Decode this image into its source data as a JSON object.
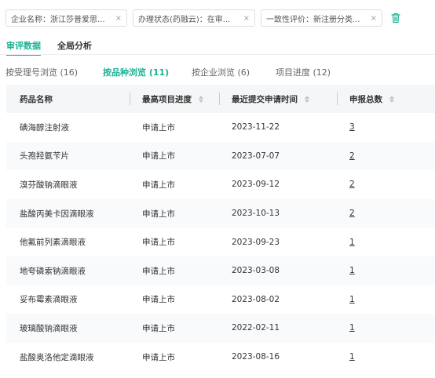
{
  "filters": [
    {
      "text": "企业名称：浙江莎普爱思...",
      "close": "×"
    },
    {
      "text": "办理状态(药融云)：在审...",
      "close": "×"
    },
    {
      "text": "一致性评价：新注册分类...",
      "close": "×"
    }
  ],
  "main_tabs": [
    "审评数据",
    "全局分析"
  ],
  "sub_tabs": [
    "按受理号浏览 (16)",
    "按品种浏览 (11)",
    "按企业浏览 (6)",
    "项目进度 (12)"
  ],
  "table": {
    "headers": [
      "药品名称",
      "最高项目进度",
      "最近提交申请时间",
      "申报总数"
    ],
    "rows": [
      [
        "碘海醇注射液",
        "申请上市",
        "2023-11-22",
        "3"
      ],
      [
        "头孢羟氨苄片",
        "申请上市",
        "2023-07-07",
        "2"
      ],
      [
        "溴芬酸钠滴眼液",
        "申请上市",
        "2023-09-12",
        "2"
      ],
      [
        "盐酸丙美卡因滴眼液",
        "申请上市",
        "2023-10-13",
        "2"
      ],
      [
        "他氟前列素滴眼液",
        "申请上市",
        "2023-09-23",
        "1"
      ],
      [
        "地夸磷索钠滴眼液",
        "申请上市",
        "2023-03-08",
        "1"
      ],
      [
        "妥布霉素滴眼液",
        "申请上市",
        "2023-08-02",
        "1"
      ],
      [
        "玻璃酸钠滴眼液",
        "申请上市",
        "2022-02-11",
        "1"
      ],
      [
        "盐酸奥洛他定滴眼液",
        "申请上市",
        "2023-08-16",
        "1"
      ]
    ]
  },
  "colors": {
    "accent": "#1ab394",
    "header_bg": "#f5f6f8",
    "alt_row_bg": "#f9fafb"
  },
  "icons": {
    "trash": "trash-icon",
    "sort": "sort-icon",
    "close": "close-icon"
  }
}
